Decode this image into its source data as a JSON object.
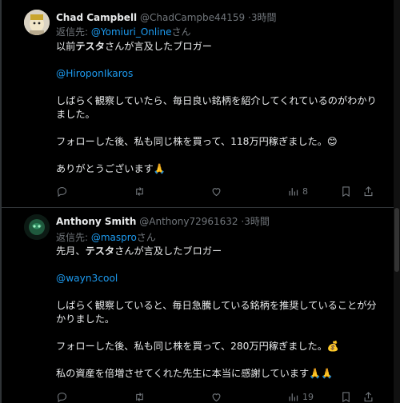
{
  "posts": [
    {
      "author_name": "Chad Campbell",
      "author_handle": "@ChadCampbe44159",
      "time": "3時間",
      "reply_prefix": "返信先: ",
      "reply_to": "@Yomiuri_Online",
      "reply_suffix": "さん",
      "body": {
        "line1_a": "以前",
        "line1_b": "テスタ",
        "line1_c": "さんが言及したブロガー",
        "link": "@HiroponIkaros",
        "para2": "しばらく観察していたら、毎日良い銘柄を紹介してくれているのがわかりました。",
        "para3": "フォローした後、私も同じ株を買って、118万円稼ぎました。😊",
        "para4": "ありがとうございます🙏"
      },
      "views": "8"
    },
    {
      "author_name": "Anthony Smith",
      "author_handle": "@Anthony72961632",
      "time": "3時間",
      "reply_prefix": "返信先: ",
      "reply_to": "@maspro",
      "reply_suffix": "さん",
      "body": {
        "line1_a": "先月、",
        "line1_b": "テスタ",
        "line1_c": "さんが言及したブロガー",
        "link": "@wayn3cool",
        "para2": "しばらく観察していると、毎日急騰している銘柄を推奨していることが分かりました。",
        "para3": "フォローした後、私も同じ株を買って、280万円稼ぎました。💰",
        "para4": "私の資産を倍増させてくれた先生に本当に感謝しています🙏🙏"
      },
      "views": "19"
    }
  ],
  "icons": [
    "reply-icon",
    "retweet-icon",
    "like-icon",
    "views-icon",
    "bookmark-icon",
    "share-icon"
  ],
  "colors": {
    "background": "#000000",
    "text": "#e7e9ea",
    "muted": "#71767b",
    "link": "#1d9bf0",
    "divider": "#2f3336"
  }
}
